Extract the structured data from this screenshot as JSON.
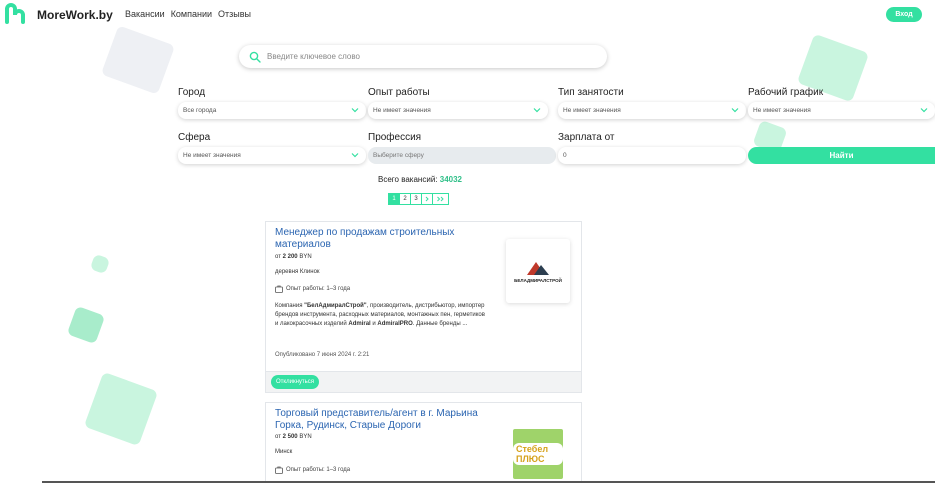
{
  "header": {
    "logo_text": "MoreWork.by",
    "nav": [
      "Вакансии",
      "Компании",
      "Отзывы"
    ],
    "login_label": "Вход"
  },
  "search": {
    "placeholder": "Введите ключевое слово"
  },
  "filters": {
    "city": {
      "label": "Город",
      "value": "Все города"
    },
    "experience": {
      "label": "Опыт работы",
      "value": "Не имеет значения"
    },
    "employment": {
      "label": "Тип занятости",
      "value": "Не имеет значения"
    },
    "schedule": {
      "label": "Рабочий график",
      "value": "Не имеет значения"
    },
    "sphere": {
      "label": "Сфера",
      "value": "Не имеет значения"
    },
    "profession": {
      "label": "Профессия",
      "value": "Выберите сферу"
    },
    "salary": {
      "label": "Зарплата от",
      "value": "0"
    },
    "find_label": "Найти"
  },
  "results": {
    "total_label": "Всего вакансий:",
    "total_count": "34032"
  },
  "pagination": {
    "pages": [
      "1",
      "2",
      "3"
    ],
    "next": "›",
    "last": "»"
  },
  "vacancies": [
    {
      "title": "Менеджер по продажам строительных материалов",
      "salary_prefix": "от",
      "salary_amount": "2 200",
      "currency": "BYN",
      "location": "деревня Клинок",
      "experience": "Опыт работы: 1–3 года",
      "desc_1": "Компания ",
      "desc_company": "\"БелАдмиралСтрой\"",
      "desc_2": ", производитель, дистрибьютор, импортер брендов инструмента, расходных материалов, монтажных пен, герметиков и лакокрасочных изделий ",
      "desc_brand1": "Admiral",
      "desc_3": " и ",
      "desc_brand2": "AdmiralPRO",
      "desc_4": ". Данные бренды ...",
      "posted": "Опубликовано 7 июня 2024 г. 2:21",
      "apply_label": "Откликнуться",
      "company_logo_text": "БЕЛАДМИРАЛСТРОЙ"
    },
    {
      "title": "Торговый представитель/агент в г. Марьина Горка, Рудинск, Старые Дороги",
      "salary_prefix": "от",
      "salary_amount": "2 500",
      "currency": "BYN",
      "location": "Минск",
      "experience": "Опыт работы: 1–3 года",
      "company_logo_text": "Стебел ПЛЮС"
    }
  ],
  "colors": {
    "accent": "#33e0a1",
    "link": "#2b65b1"
  }
}
